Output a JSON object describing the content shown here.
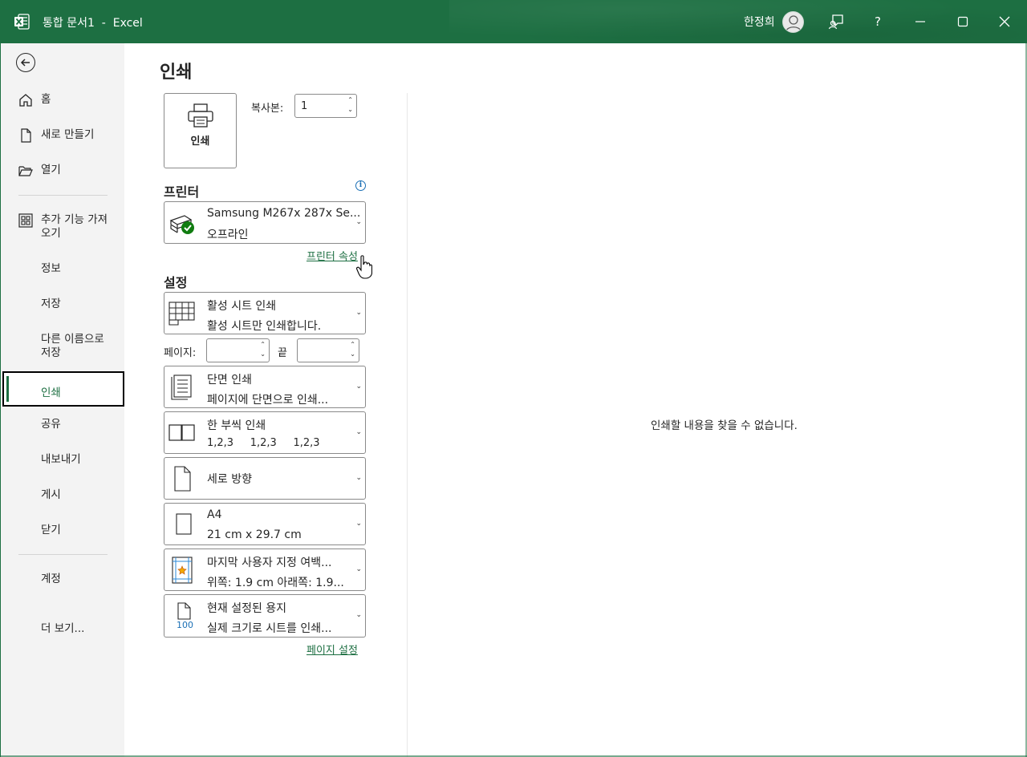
{
  "titlebar": {
    "title": "통합 문서1  -  Excel",
    "user_name": "한정희",
    "app_color": "#1d6f42"
  },
  "nav": {
    "back_icon": "back-arrow-icon",
    "items": [
      {
        "label": "홈",
        "icon": "home-icon"
      },
      {
        "label": "새로 만들기",
        "icon": "new-document-icon"
      },
      {
        "label": "열기",
        "icon": "open-folder-icon"
      },
      {
        "label": "추가 기능 가져오기_1",
        "icon": "addins-icon"
      },
      {
        "label": "정보"
      },
      {
        "label": "저장"
      },
      {
        "label": "다른 이름으로 저장"
      },
      {
        "label": "인쇄",
        "selected": true
      },
      {
        "label": "공유"
      },
      {
        "label": "내보내기"
      },
      {
        "label": "게시"
      },
      {
        "label": "닫기"
      },
      {
        "label": "계정"
      },
      {
        "label": "더 보기..."
      }
    ],
    "addins_line1": "추가 기능 가져",
    "addins_line2": "오기",
    "saveas_line1": "다른 이름으로",
    "saveas_line2": "저장"
  },
  "main": {
    "title": "인쇄",
    "print_button": "인쇄",
    "copies_label": "복사본:",
    "copies_value": "1",
    "printer_heading": "프린터",
    "printer": {
      "name": "Samsung M267x 287x Se...",
      "status": "오프라인"
    },
    "printer_props_link": "프린터 속성",
    "settings_heading": "설정",
    "settings": [
      {
        "line1": "활성 시트 인쇄",
        "line2": "활성 시트만 인쇄합니다.",
        "icon": "sheet-grid-icon"
      },
      {
        "line1": "단면 인쇄",
        "line2": "페이지에 단면으로 인쇄...",
        "icon": "one-sided-icon"
      },
      {
        "line1": "한 부씩 인쇄",
        "line2": "1,2,3     1,2,3     1,2,3",
        "icon": "collated-icon"
      },
      {
        "line1": "세로 방향",
        "line2": "",
        "icon": "portrait-icon"
      },
      {
        "line1": "A4",
        "line2": "21 cm x 29.7 cm",
        "icon": "paper-size-icon"
      },
      {
        "line1": "마지막 사용자 지정 여백...",
        "line2": "위쪽: 1.9 cm 아래쪽: 1.9...",
        "icon": "margins-icon"
      },
      {
        "line1": "현재 설정된 용지",
        "line2": "실제 크기로 시트를 인쇄...",
        "icon": "scaling-icon"
      }
    ],
    "pages_label": "페이지:",
    "pages_from": "",
    "pages_to_label": "끝",
    "pages_to": "",
    "page_setup_link": "페이지 설정",
    "preview_message": "인쇄할 내용을 찾을 수 없습니다."
  }
}
